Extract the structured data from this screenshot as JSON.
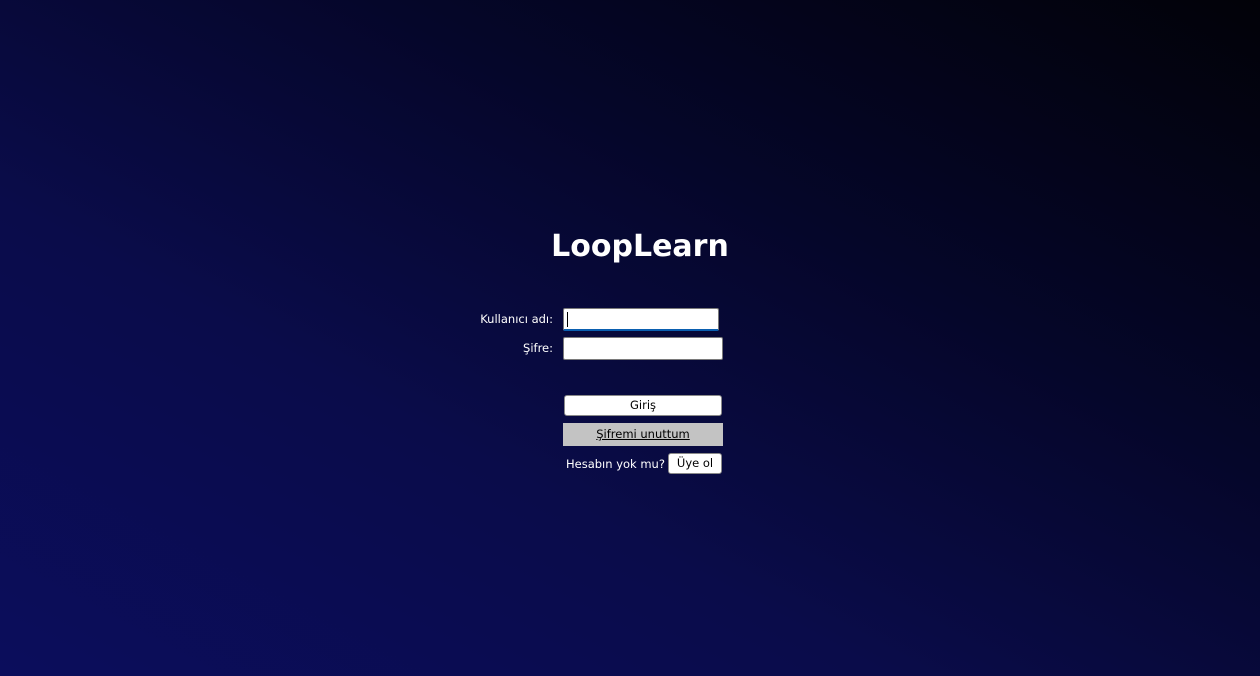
{
  "app": {
    "title": "LoopLearn"
  },
  "login_form": {
    "username_label": "Kullanıcı adı:",
    "username_value": "",
    "password_label": "Şifre:",
    "password_value": "",
    "login_button": "Giriş",
    "forgot_password_link": "Şifremi unuttum",
    "no_account_text": "Hesabın yok mu?",
    "signup_button": "Üye ol"
  },
  "colors": {
    "background_top": "#020208",
    "background_bottom": "#0b0d5c",
    "text": "#ffffff",
    "focus_accent": "#0a5fb0",
    "link_background": "#c3c3c3"
  }
}
